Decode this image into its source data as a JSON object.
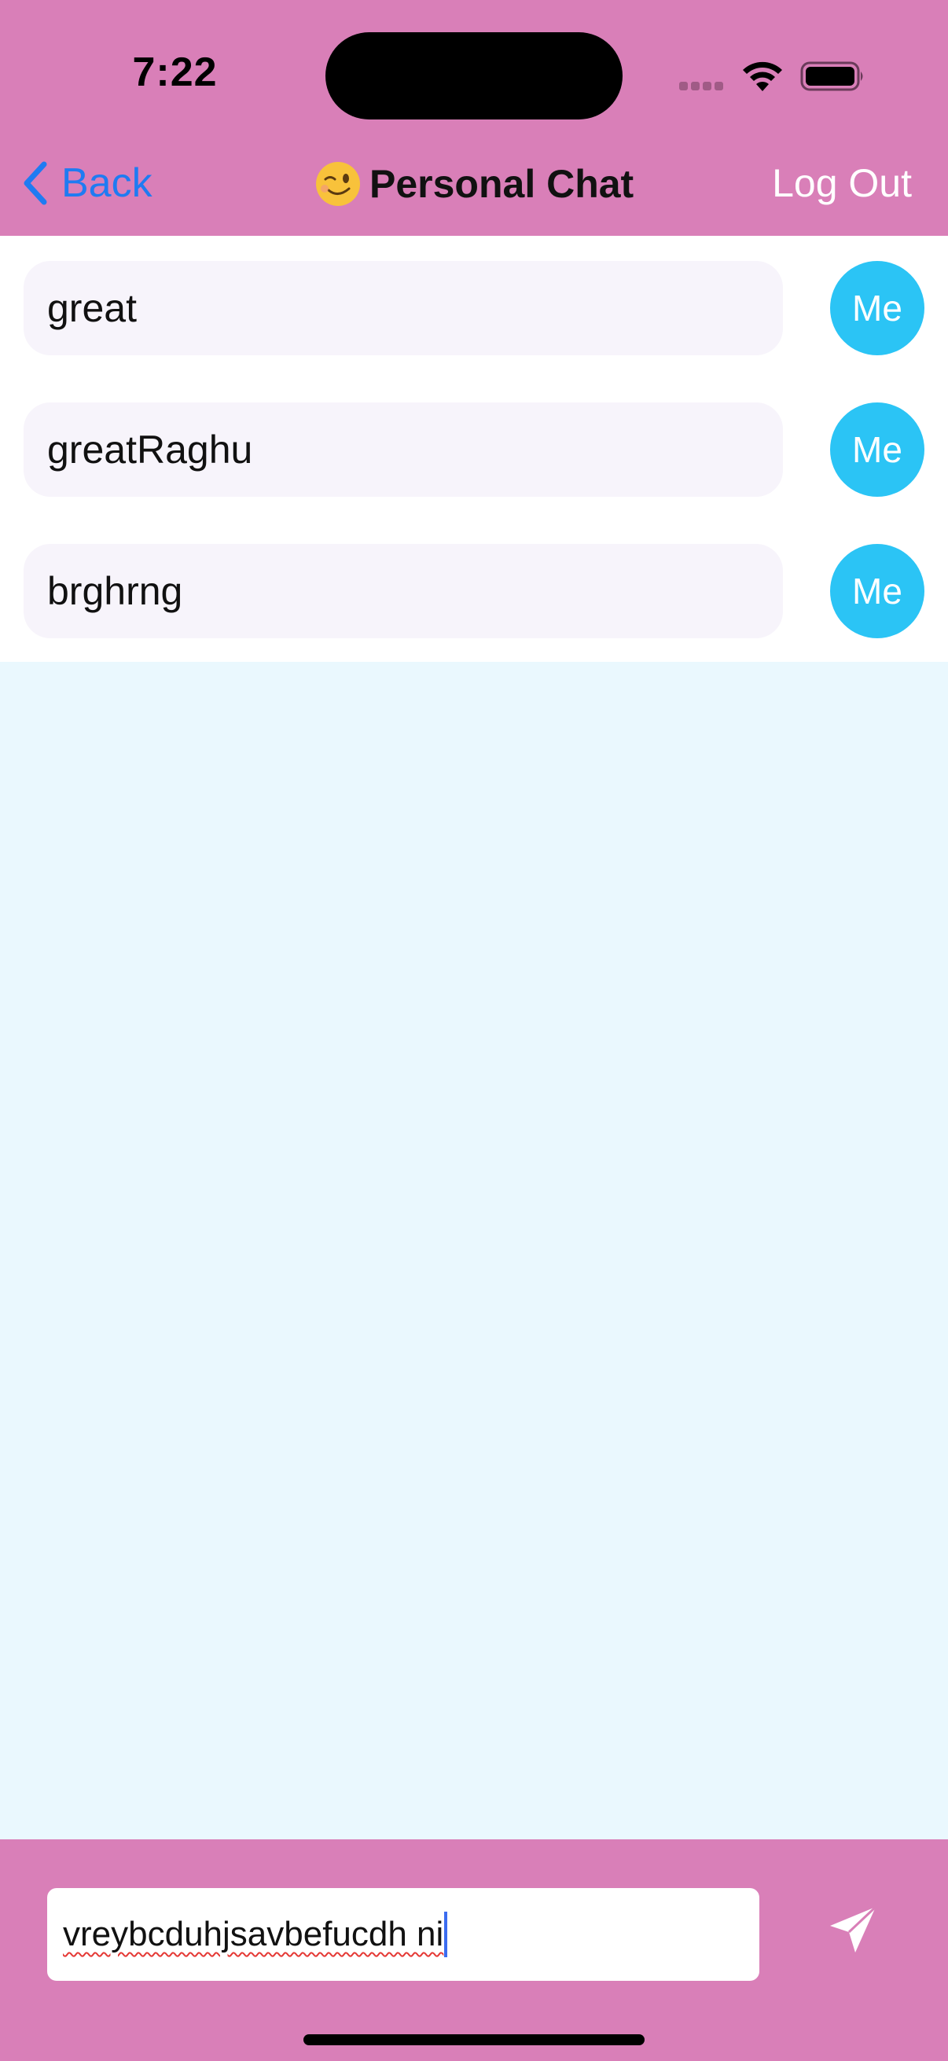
{
  "status_bar": {
    "time": "7:22"
  },
  "nav_bar": {
    "back_label": "Back",
    "title_emoji": "😉",
    "title": "Personal Chat",
    "logout_label": "Log Out"
  },
  "messages": [
    {
      "text": "great",
      "avatar": "Me"
    },
    {
      "text": "greatRaghu",
      "avatar": "Me"
    },
    {
      "text": "brghrng",
      "avatar": "Me"
    }
  ],
  "composer": {
    "input_value": "vreybcduhjsavbefucdh ni",
    "send_icon": "paper-plane-icon"
  },
  "colors": {
    "header_bg": "#d97fb8",
    "accent_blue": "#1f7bf2",
    "avatar_bg": "#2bc4f5",
    "list_bg": "#ffffff",
    "canvas_bg": "#eaf8fe",
    "bubble_bg": "#f7f4fb"
  }
}
